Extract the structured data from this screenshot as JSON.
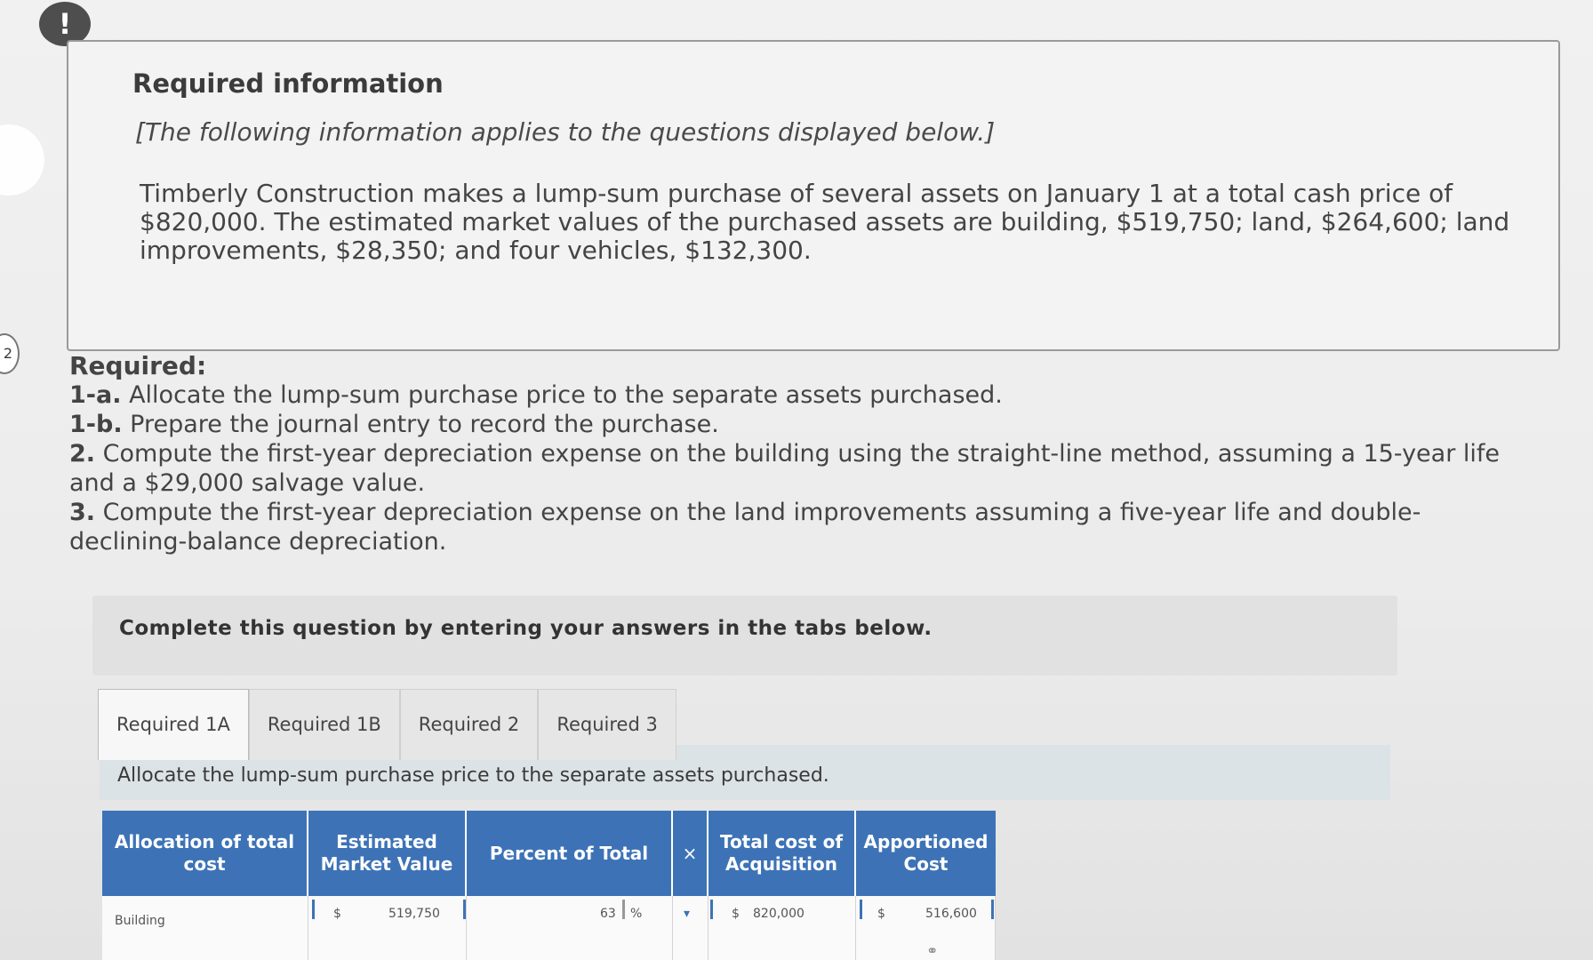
{
  "alert_badge": "!",
  "question_number": "2",
  "info": {
    "title": "Required information",
    "subtitle": "[The following information applies to the questions displayed below.]",
    "body": "Timberly Construction makes a lump-sum purchase of several assets on January 1 at a total cash price of $820,000. The estimated market values of the purchased assets are building, $519,750; land, $264,600; land improvements, $28,350; and four vehicles, $132,300."
  },
  "required": {
    "heading": "Required:",
    "items": [
      {
        "num": "1-a.",
        "text": "Allocate the lump-sum purchase price to the separate assets purchased."
      },
      {
        "num": "1-b.",
        "text": "Prepare the journal entry to record the purchase."
      },
      {
        "num": "2.",
        "text": "Compute the first-year depreciation expense on the building using the straight-line method, assuming a 15-year life and a $29,000 salvage value."
      },
      {
        "num": "3.",
        "text": "Compute the first-year depreciation expense on the land improvements assuming a five-year life and double-declining-balance depreciation."
      }
    ]
  },
  "complete_text": "Complete this question by entering your answers in the tabs below.",
  "tabs": [
    "Required 1A",
    "Required 1B",
    "Required 2",
    "Required 3"
  ],
  "active_tab": "Required 1A",
  "allocate_text": "Allocate the lump-sum purchase price to the separate assets purchased.",
  "table": {
    "headers": [
      "Allocation of total cost",
      "Estimated Market Value",
      "Percent of Total",
      "×",
      "Total cost of Acquisition",
      "Apportioned Cost"
    ],
    "row": {
      "label": "Building",
      "market_currency": "$",
      "market_value": "519,750",
      "percent": "63",
      "percent_sign": "%",
      "total_currency": "$",
      "total_cost": "820,000",
      "apportioned_currency": "$",
      "apportioned": "516,600"
    }
  },
  "colors": {
    "table_header": "#3d73b6",
    "alert_badge": "#4e4e4e"
  },
  "icons": [
    "chain-link-icon"
  ]
}
